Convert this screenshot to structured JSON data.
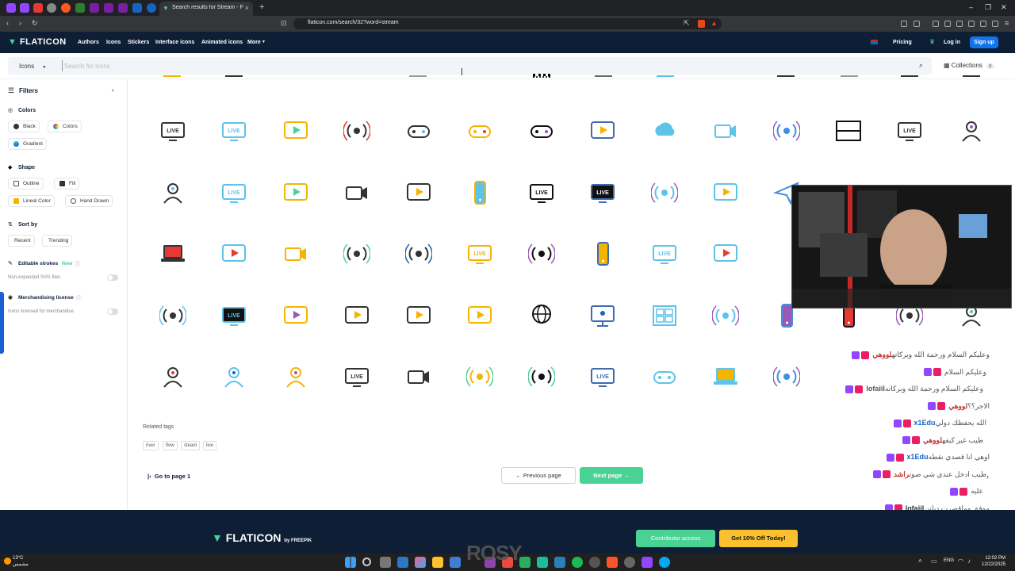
{
  "browser": {
    "active_tab_title": "Search results for Stream - Flati",
    "url": "flaticon.com/search/32?word=stream"
  },
  "header": {
    "logo": "FLATICON",
    "nav": [
      "Authors",
      "Icons",
      "Stickers",
      "Interface icons",
      "Animated icons",
      "More"
    ],
    "pricing": "Pricing",
    "login": "Log in",
    "signup": "Sign up"
  },
  "search": {
    "type": "Icons",
    "placeholder": "Search for icons",
    "collections_label": "Collections",
    "collections_count": "0"
  },
  "sidebar": {
    "title": "Filters",
    "colors_title": "Colors",
    "colors": [
      "Black",
      "Colors",
      "Gradient"
    ],
    "shape_title": "Shape",
    "shapes": [
      "Outline",
      "Fill",
      "Lineal Color",
      "Hand Drawn"
    ],
    "sort_title": "Sort by",
    "sort": [
      "Recent",
      "Trending"
    ],
    "editable_title": "Editable strokes",
    "editable_badge": "New",
    "editable_sub": "Non-expanded SVG files.",
    "merch_title": "Merchandising license",
    "merch_sub": "Icons licensed for merchandise."
  },
  "icon_grid": {
    "rows": [
      [
        "live-tv",
        "live-stream-person",
        "video-laptop",
        "radio-broadcast",
        "gamepad",
        "gamepad-color",
        "gamepad-black",
        "monitor-display",
        "cloud-music",
        "webcam-stand",
        "wireless-signal",
        "window-frame",
        "live-monitor",
        "user-monitor"
      ],
      [
        "user-avatar",
        "live-microphone",
        "video-camera",
        "webcam-globe",
        "video-player",
        "phone-stream",
        "live-tv-outline",
        "live-tv-black",
        "cast-screen",
        "tv-play",
        "paper-plane",
        "",
        "",
        ""
      ],
      [
        "laptop-red",
        "laptop-play",
        "desktop-camera",
        "camera-wifi",
        "camera-cast",
        "live-globe",
        "camera-signal",
        "phone-mic",
        "live-video",
        "youtube-5g",
        "",
        "",
        "",
        ""
      ],
      [
        "screen-cast",
        "live-signal",
        "play-circle",
        "monitor-video",
        "video-screen",
        "photo-video",
        "www-monitor",
        "tv-retro",
        "grid-dashboard",
        "broadcast-purple",
        "megaphone",
        "megaphone-red",
        "person-signal",
        "agent-support"
      ],
      [
        "face-profile",
        "team-streaming",
        "desk-person",
        "live-browser",
        "heart-camera",
        "play-wifi",
        "monitor-signal",
        "live-camera",
        "game-controller",
        "laptop-yellow",
        "broadcast-round",
        "",
        "",
        ""
      ]
    ]
  },
  "related": {
    "title": "Related tags",
    "tags": [
      "river",
      "flow",
      "steam",
      "live"
    ]
  },
  "pagination": {
    "first": "Go to page 1",
    "prev": "Previous page",
    "next": "Next page"
  },
  "footer": {
    "logo": "FLATICON",
    "by": "by FREEPIK",
    "contributor": "Contributor access",
    "offer": "Get 10% Off Today!"
  },
  "taskbar": {
    "weather_temp": "13°C",
    "weather_desc": "مشمس",
    "lang": "ENG",
    "time": "12:02 PM",
    "date": "12/22/2025"
  },
  "watermark": "ROSY",
  "chat": [
    {
      "name": "لووهي",
      "text": "وعليكم السلام ورحمة الله وبركاته",
      "color": "#c0392b"
    },
    {
      "name": "",
      "text": "وعليكم السلام",
      "color": "#333"
    },
    {
      "name": "lofaiil",
      "text": "وعليكم السلام ورحمة الله وبركاته",
      "color": "#555"
    },
    {
      "name": "لووهي",
      "text": "الاجر؟؟",
      "color": "#c0392b"
    },
    {
      "name": "x1Edu",
      "text": "الله يحفظك دولي",
      "color": "#1565c0"
    },
    {
      "name": "لووهي",
      "text": "طيب غير كيفه",
      "color": "#c0392b"
    },
    {
      "name": "x1Edu",
      "text": "اوهي انا قصدي نقطه",
      "color": "#1565c0"
    },
    {
      "name": "راشد",
      "text": "طيب ادخل عندي شي صوت",
      "color": "#c0392b"
    },
    {
      "name": "",
      "text": "عليه",
      "color": "#333"
    },
    {
      "name": "lofaiil",
      "text": "موفق وماقصرت ديلنن",
      "color": "#333"
    }
  ]
}
